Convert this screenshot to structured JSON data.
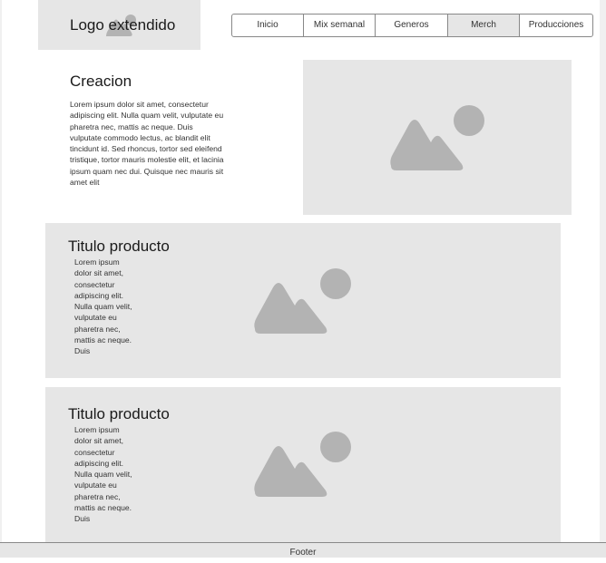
{
  "header": {
    "logo_text": "Logo extendido",
    "logo_icon": "image-placeholder-icon"
  },
  "nav": {
    "items": [
      {
        "label": "Inicio"
      },
      {
        "label": "Mix semanal"
      },
      {
        "label": "Generos"
      },
      {
        "label": "Merch",
        "active": true
      },
      {
        "label": "Producciones"
      }
    ]
  },
  "creacion": {
    "title": "Creacion",
    "body": "Lorem ipsum dolor sit amet, consectetur adipiscing elit. Nulla quam velit, vulputate eu pharetra nec, mattis ac neque. Duis vulputate commodo lectus, ac blandit elit tincidunt id. Sed rhoncus, tortor sed eleifend tristique, tortor mauris molestie elit, et lacinia ipsum quam nec dui. Quisque nec mauris sit amet elit",
    "image_icon": "image-placeholder-icon"
  },
  "products": [
    {
      "title": "Titulo producto",
      "body": "Lorem ipsum dolor sit amet, consectetur adipiscing elit. Nulla quam velit, vulputate eu pharetra nec, mattis ac neque. Duis",
      "image_icon": "image-placeholder-icon"
    },
    {
      "title": "Titulo producto",
      "body": "Lorem ipsum dolor sit amet, consectetur adipiscing elit. Nulla quam velit, vulputate eu pharetra nec, mattis ac neque. Duis",
      "image_icon": "image-placeholder-icon"
    }
  ],
  "footer": {
    "text": "Footer"
  },
  "colors": {
    "placeholder_bg": "#e6e6e6",
    "placeholder_icon": "#b3b3b3",
    "border": "#888888"
  }
}
